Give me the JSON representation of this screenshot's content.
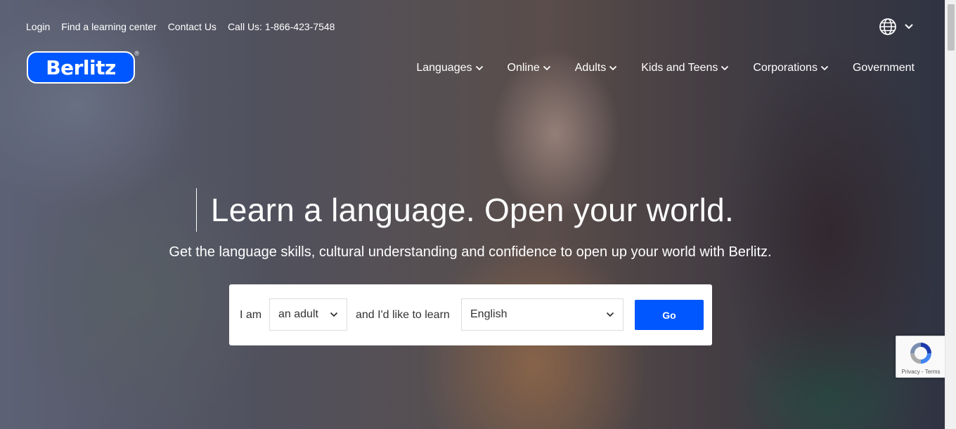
{
  "utility_nav": {
    "login": "Login",
    "find_center": "Find a learning center",
    "contact": "Contact Us",
    "phone": "Call Us: 1-866-423-7548"
  },
  "logo": {
    "text": "Berlitz",
    "reg": "®"
  },
  "main_nav": [
    {
      "label": "Languages",
      "icon": "chevron-down-icon"
    },
    {
      "label": "Online",
      "icon": "chevron-down-icon"
    },
    {
      "label": "Adults",
      "icon": "chevron-down-icon"
    },
    {
      "label": "Kids and Teens",
      "icon": "chevron-down-icon"
    },
    {
      "label": "Corporations",
      "icon": "chevron-down-icon"
    },
    {
      "label": "Government"
    }
  ],
  "hero": {
    "title": "Learn a language. Open your world.",
    "subtitle": "Get the language skills, cultural understanding and confidence to open up your world with Berlitz."
  },
  "finder": {
    "label_i_am": "I am",
    "audience_value": "an adult",
    "label_learn": "and I'd like to learn",
    "language_value": "English",
    "go_label": "Go"
  },
  "recaptcha": {
    "text": "Privacy - Terms"
  },
  "colors": {
    "brand": "#0057ff",
    "text_white": "#ffffff"
  }
}
